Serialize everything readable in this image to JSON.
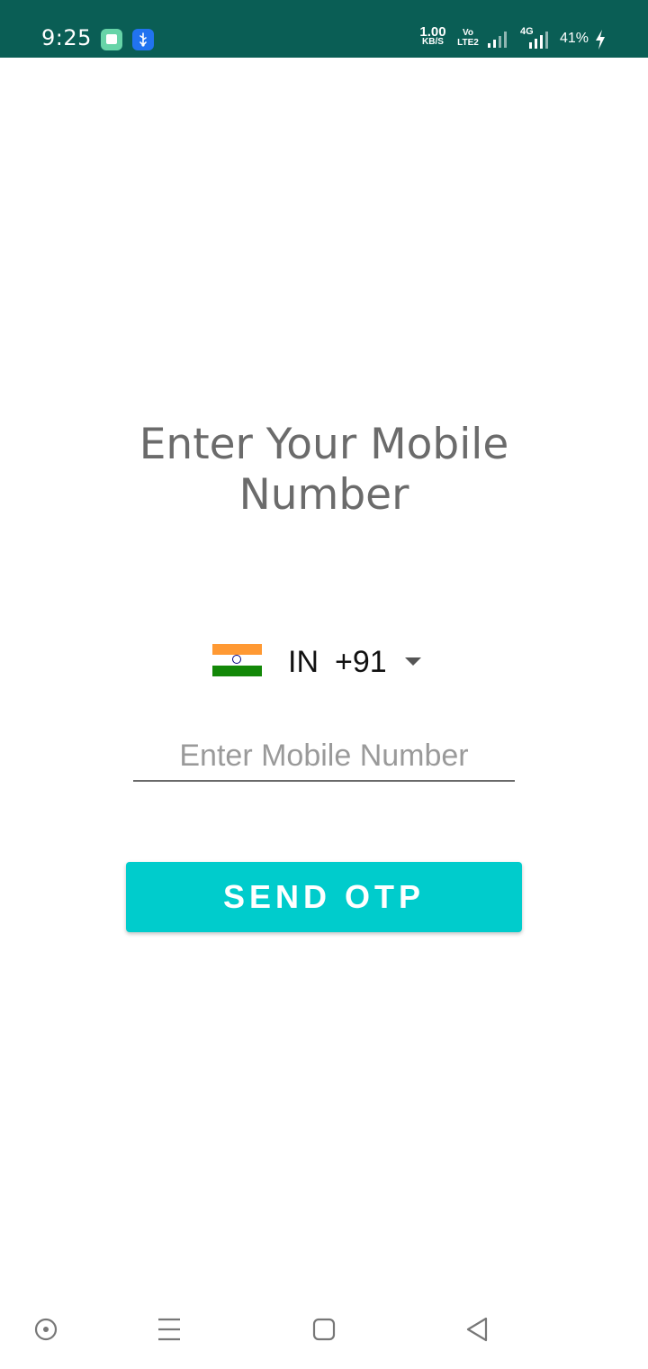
{
  "status_bar": {
    "time": "9:25",
    "net_speed_value": "1.00",
    "net_speed_unit": "KB/S",
    "volte_top": "Vo",
    "volte_bottom": "LTE2",
    "network_type": "4G",
    "battery": "41%",
    "background_color": "#0a5e55",
    "icons": [
      "gallery-notification-icon",
      "usb-notification-icon",
      "signal-icon",
      "battery-charging-icon"
    ]
  },
  "login": {
    "title_line1": "Enter Your Mobile",
    "title_line2": "Number",
    "country": {
      "flag": "india-flag-icon",
      "iso": "IN",
      "dial_code": "+91"
    },
    "phone_input": {
      "value": "",
      "placeholder": "Enter Mobile Number"
    },
    "send_button_label": "SEND OTP",
    "accent_color": "#00cccc"
  },
  "nav_bar": {
    "buttons": [
      "assistant-icon",
      "menu-icon",
      "home-icon",
      "back-icon"
    ]
  }
}
